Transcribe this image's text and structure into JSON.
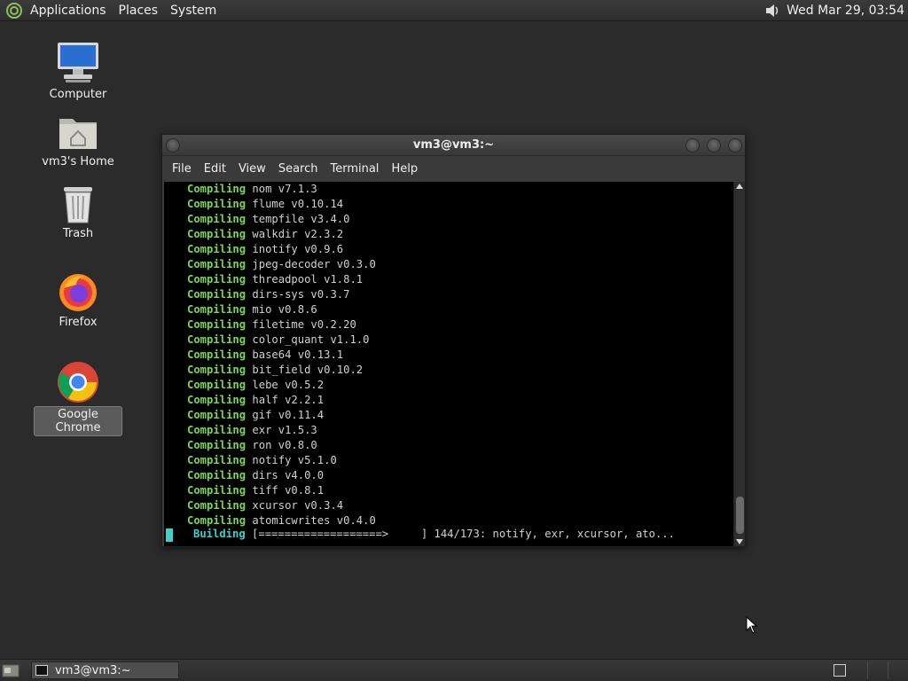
{
  "top_panel": {
    "menus": [
      "Applications",
      "Places",
      "System"
    ],
    "clock": "Wed Mar 29, 03:54"
  },
  "desktop": {
    "icons": [
      {
        "label": "Computer",
        "icon": "computer-icon"
      },
      {
        "label": "vm3's Home",
        "icon": "home-folder-icon"
      },
      {
        "label": "Trash",
        "icon": "trash-icon"
      },
      {
        "label": "Firefox",
        "icon": "firefox-icon"
      },
      {
        "label": "Google Chrome",
        "icon": "chrome-icon"
      }
    ]
  },
  "terminal": {
    "title": "vm3@vm3:~",
    "menu": [
      "File",
      "Edit",
      "View",
      "Search",
      "Terminal",
      "Help"
    ],
    "keyword": "Compiling",
    "lines": [
      "nom v7.1.3",
      "flume v0.10.14",
      "tempfile v3.4.0",
      "walkdir v2.3.2",
      "inotify v0.9.6",
      "jpeg-decoder v0.3.0",
      "threadpool v1.8.1",
      "dirs-sys v0.3.7",
      "mio v0.8.6",
      "filetime v0.2.20",
      "color_quant v1.1.0",
      "base64 v0.13.1",
      "bit_field v0.10.2",
      "lebe v0.5.2",
      "half v2.2.1",
      "gif v0.11.4",
      "exr v1.5.3",
      "ron v0.8.0",
      "notify v5.1.0",
      "dirs v4.0.0",
      "tiff v0.8.1",
      "xcursor v0.3.4",
      "atomicwrites v0.4.0"
    ],
    "build_keyword": "Building",
    "build_rest": "[===================>     ] 144/173: notify, exr, xcursor, ato...",
    "colors": {
      "compiling": "#7ad84e",
      "building": "#3fd0c8"
    }
  },
  "taskbar": {
    "task_label": "vm3@vm3:~"
  }
}
